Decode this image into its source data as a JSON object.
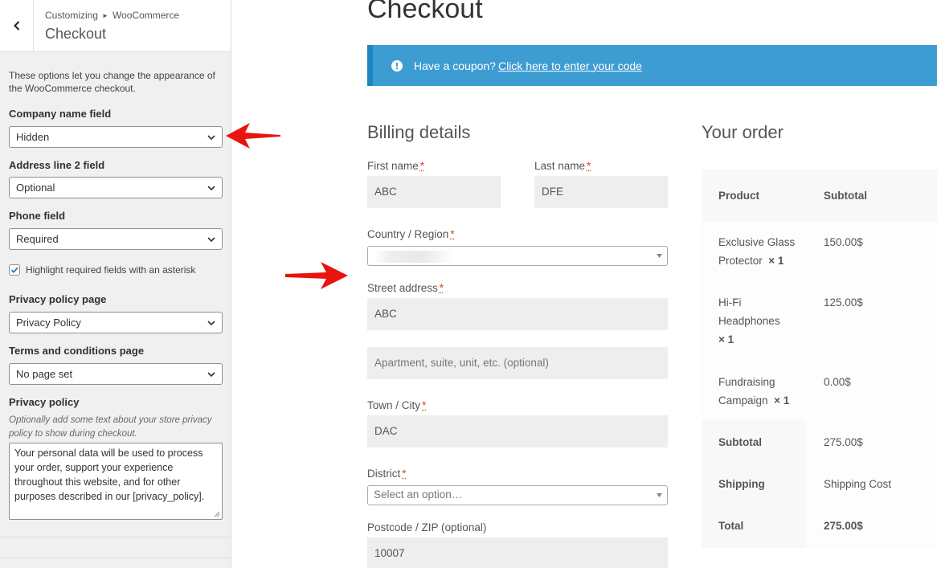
{
  "sidebar": {
    "breadcrumb_parent": "Customizing",
    "breadcrumb_section": "WooCommerce",
    "title": "Checkout",
    "description": "These options let you change the appearance of the WooCommerce checkout.",
    "company_field": {
      "label": "Company name field",
      "value": "Hidden"
    },
    "address2_field": {
      "label": "Address line 2 field",
      "value": "Optional"
    },
    "phone_field": {
      "label": "Phone field",
      "value": "Required"
    },
    "highlight_required": {
      "label": "Highlight required fields with an asterisk",
      "checked": true
    },
    "privacy_page": {
      "label": "Privacy policy page",
      "value": "Privacy Policy"
    },
    "terms_page": {
      "label": "Terms and conditions page",
      "value": "No page set"
    },
    "privacy_policy": {
      "label": "Privacy policy",
      "hint": "Optionally add some text about your store privacy policy to show during checkout.",
      "text": "Your personal data will be used to process your order, support your experience throughout this website, and for other purposes described in our [privacy_policy]."
    }
  },
  "checkout": {
    "title": "Checkout",
    "coupon_text": "Have a coupon?",
    "coupon_link": "Click here to enter your code",
    "billing_heading": "Billing details",
    "required_mark": "*",
    "fields": {
      "first_name": {
        "label": "First name",
        "value": "ABC"
      },
      "last_name": {
        "label": "Last name",
        "value": "DFE"
      },
      "country": {
        "label": "Country / Region",
        "value": ""
      },
      "street": {
        "label": "Street address",
        "value": "ABC",
        "placeholder2": "Apartment, suite, unit, etc. (optional)"
      },
      "city": {
        "label": "Town / City",
        "value": "DAC"
      },
      "district": {
        "label": "District",
        "placeholder": "Select an option…"
      },
      "postcode": {
        "label": "Postcode / ZIP (optional)",
        "value": "10007"
      }
    },
    "order": {
      "heading": "Your order",
      "col_product": "Product",
      "col_subtotal": "Subtotal",
      "items": [
        {
          "name_line1": "Exclusive Glass",
          "name_line2": "Protector",
          "qty": "× 1",
          "price": "150.00$"
        },
        {
          "name_line1": "Hi-Fi",
          "name_line2": "Headphones",
          "qty": "× 1",
          "price": "125.00$"
        },
        {
          "name_line1": "Fundraising",
          "name_line2": "Campaign",
          "qty": "× 1",
          "price": "0.00$"
        }
      ],
      "subtotal_label": "Subtotal",
      "subtotal_value": "275.00$",
      "shipping_label": "Shipping",
      "shipping_value": "Shipping Cost",
      "total_label": "Total",
      "total_value": "275.00$"
    }
  },
  "colors": {
    "coupon_bg": "#3d9cd2",
    "coupon_border": "#1e85be",
    "arrow": "#e8140e",
    "required": "#e2401c",
    "wp_blue": "#2271b1"
  },
  "icons": [
    "back-chevron-icon",
    "chevron-down-icon",
    "checkmark-icon",
    "info-icon",
    "arrow-left-icon",
    "arrow-right-icon"
  ]
}
